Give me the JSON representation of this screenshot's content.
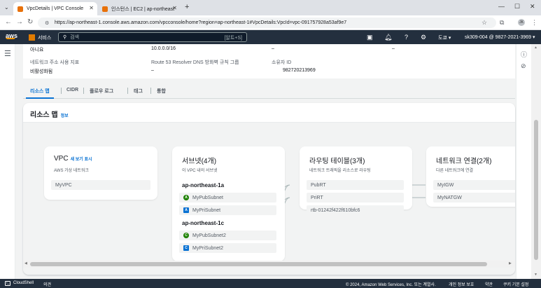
{
  "browser": {
    "tabs": [
      {
        "title": "VpcDetails | VPC Console",
        "active": true,
        "favicon_color": "#e8710a"
      },
      {
        "title": "인스턴스 | EC2 | ap-northeast",
        "active": false,
        "favicon_color": "#e8710a"
      }
    ],
    "url": "https://ap-northeast-1.console.aws.amazon.com/vpcconsole/home?region=ap-northeast-1#VpcDetails:VpcId=vpc-091757928a53af9e7",
    "profile_initials": "JK"
  },
  "aws_header": {
    "logo": "aws",
    "services_label": "서비스",
    "search_placeholder": "검색",
    "search_hint": "[알트+S]",
    "region": "도쿄 ▾",
    "account": "sk309-004 @ 9827-2021-3969 ▾"
  },
  "details": {
    "row1": [
      {
        "value": "아니요"
      },
      {
        "value": "10.0.0.0/16"
      },
      {
        "value": "–"
      },
      {
        "value": "–"
      }
    ],
    "row2": [
      {
        "label": "네트워크 주소 사용 지표",
        "value": "비활성화됨"
      },
      {
        "label": "Route 53 Resolver DNS 방화벽 규칙 그룹",
        "value": "–"
      },
      {
        "label": "소유자 ID",
        "value": "982720213969"
      }
    ]
  },
  "detail_tabs": [
    "리소스 맵",
    "CIDR",
    "플로우 로그",
    "태그",
    "통합"
  ],
  "resource_map": {
    "title": "리소스 맵",
    "info": "정보",
    "vpc": {
      "title": "VPC",
      "link": "새 보기 표시",
      "subtitle": "AWS 가상 네트워크",
      "items": [
        "MyVPC"
      ]
    },
    "subnets": {
      "title": "서브넷(4개)",
      "subtitle": "이 VPC 내의 서브넷",
      "groups": [
        {
          "az": "ap-northeast-1a",
          "items": [
            {
              "badge": "A",
              "type": "pub",
              "name": "MyPubSubnet"
            },
            {
              "badge": "A",
              "type": "pri",
              "name": "MyPriSubnet"
            }
          ]
        },
        {
          "az": "ap-northeast-1c",
          "items": [
            {
              "badge": "C",
              "type": "pub",
              "name": "MyPubSubnet2"
            },
            {
              "badge": "C",
              "type": "pri",
              "name": "MyPriSubnet2"
            }
          ]
        }
      ]
    },
    "route_tables": {
      "title": "라우팅 테이블(3개)",
      "subtitle": "네트워크 트래픽을 리소스로 라우팅",
      "items": [
        "PubRT",
        "PriRT",
        "rtb-01242f422f610bfc6"
      ]
    },
    "network_connections": {
      "title": "네트워크 연결(2개)",
      "subtitle": "다른 네트워크에 연결",
      "items": [
        "MyIGW",
        "MyNATGW"
      ]
    }
  },
  "footer": {
    "cloudshell": "CloudShell",
    "feedback": "의견",
    "copyright": "© 2024, Amazon Web Services, Inc. 또는 계열사.",
    "privacy": "개인 정보 보호",
    "terms": "약관",
    "cookies": "쿠키 기본 설정"
  }
}
